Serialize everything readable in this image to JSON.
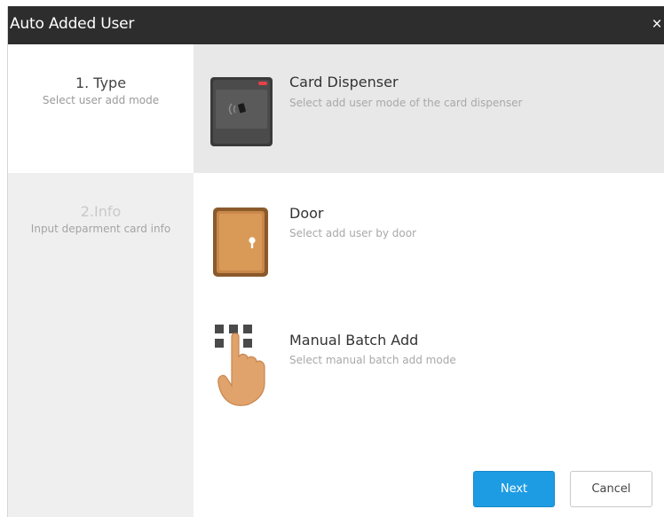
{
  "window": {
    "title": "Auto Added User",
    "close_glyph": "×"
  },
  "steps": [
    {
      "title": "1. Type",
      "subtitle": "Select user add mode",
      "state": "active"
    },
    {
      "title": "2.Info",
      "subtitle": "Input deparment card info",
      "state": "inactive"
    }
  ],
  "options": [
    {
      "title": "Card Dispenser",
      "description": "Select add user mode of the card dispenser",
      "icon": "card-dispenser-icon",
      "selected": true
    },
    {
      "title": "Door",
      "description": "Select add user by door",
      "icon": "door-icon",
      "selected": false
    },
    {
      "title": "Manual Batch Add",
      "description": "Select manual batch add mode",
      "icon": "hand-keypad-icon",
      "selected": false
    }
  ],
  "buttons": {
    "next": "Next",
    "cancel": "Cancel"
  },
  "colors": {
    "titlebar": "#2d2d2d",
    "selected_option": "#e8e8e8",
    "sidebar": "#efefef",
    "primary": "#1e9ce3"
  }
}
